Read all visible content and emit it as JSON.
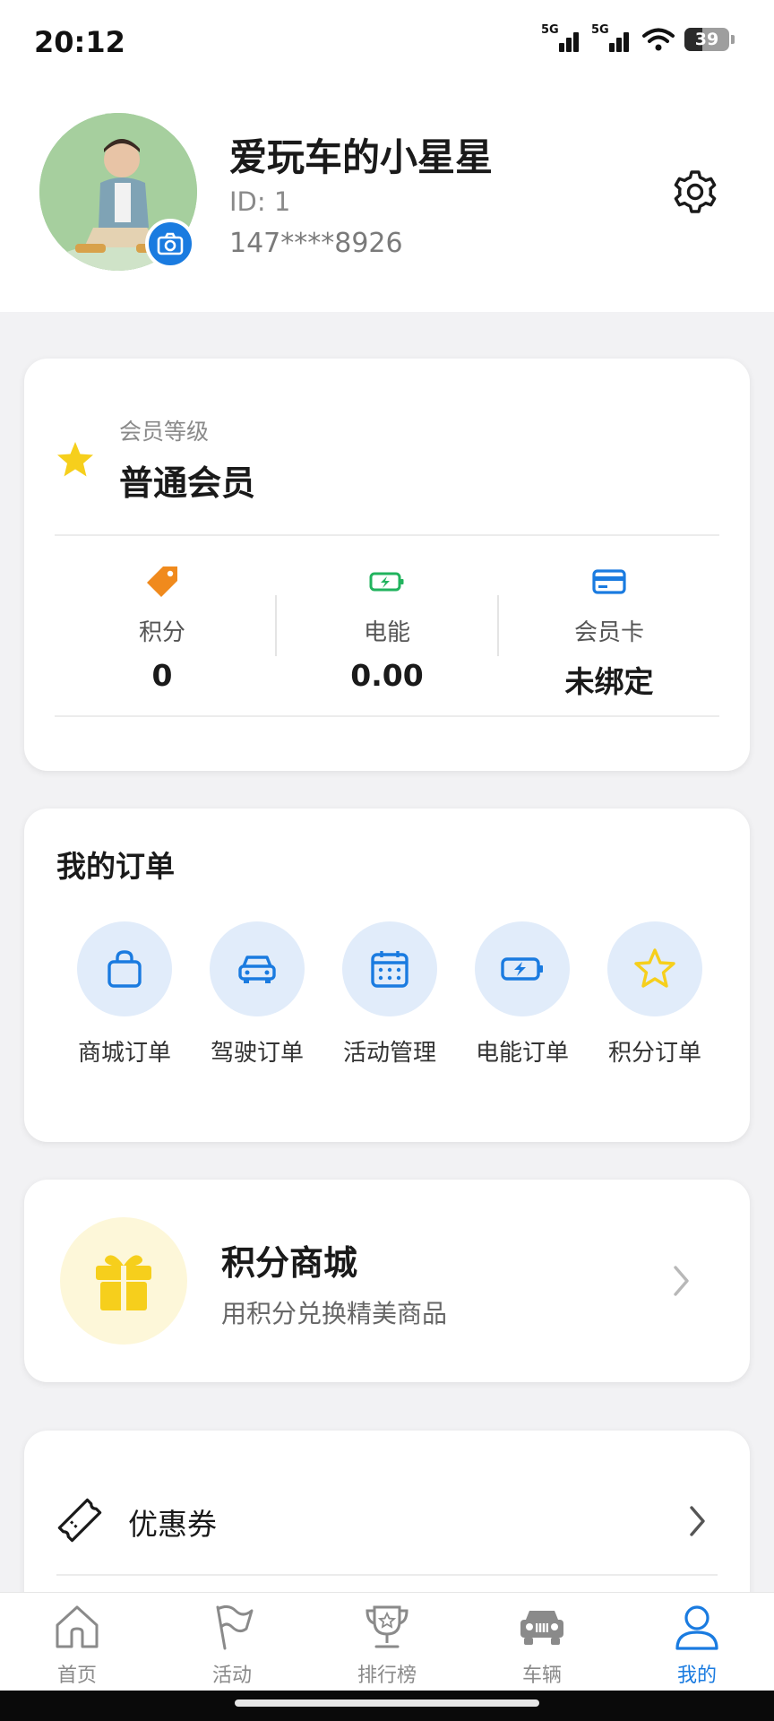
{
  "status_bar": {
    "time": "20:12",
    "network1": "5G",
    "network2": "5G",
    "battery": "39"
  },
  "profile": {
    "nickname": "爱玩车的小星星",
    "id": "ID: 1",
    "phone": "147****8926"
  },
  "membership": {
    "level_label": "会员等级",
    "level_name": "普通会员",
    "stats": [
      {
        "label": "积分",
        "value": "0",
        "icon": "tag-icon"
      },
      {
        "label": "电能",
        "value": "0.00",
        "icon": "battery-charge-icon"
      },
      {
        "label": "会员卡",
        "value": "未绑定",
        "icon": "card-icon"
      }
    ]
  },
  "orders": {
    "title": "我的订单",
    "items": [
      {
        "label": "商城订单",
        "icon": "shopping-bag-icon"
      },
      {
        "label": "驾驶订单",
        "icon": "car-icon"
      },
      {
        "label": "活动管理",
        "icon": "calendar-icon"
      },
      {
        "label": "电能订单",
        "icon": "battery-charge-icon"
      },
      {
        "label": "积分订单",
        "icon": "star-icon"
      }
    ]
  },
  "mall": {
    "title": "积分商城",
    "subtitle": "用积分兑换精美商品"
  },
  "coupon": {
    "label": "优惠券"
  },
  "tabbar": {
    "items": [
      {
        "label": "首页",
        "icon": "home-icon",
        "active": false
      },
      {
        "label": "活动",
        "icon": "flag-icon",
        "active": false
      },
      {
        "label": "排行榜",
        "icon": "trophy-icon",
        "active": false
      },
      {
        "label": "车辆",
        "icon": "jeep-icon",
        "active": false
      },
      {
        "label": "我的",
        "icon": "user-icon",
        "active": true
      }
    ]
  },
  "colors": {
    "accent": "#1a7be0",
    "star": "#f6cf1c",
    "orange": "#f08a1d",
    "green": "#22b35e",
    "light_blue": "#e1ecfa"
  }
}
